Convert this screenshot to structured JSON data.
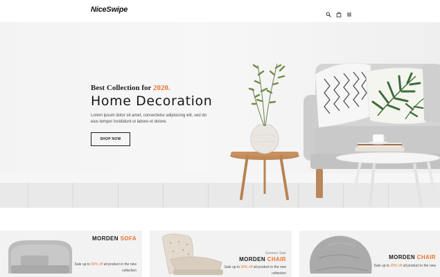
{
  "header": {
    "logo": "NiceSwipe",
    "icons": [
      "search-icon",
      "bag-icon",
      "menu-icon"
    ]
  },
  "hero": {
    "eyebrow_prefix": "Best Collection for",
    "eyebrow_year": "2020.",
    "title": "Home Decoration",
    "text": "Lorem ipsum dolor sit amet, consectetur adipisicing elit, sed do eius tempor incididunt ut labore et dolore.",
    "button_label": "SHOP NOW"
  },
  "cards": [
    {
      "eyebrow": "",
      "title_main": "MORDEN",
      "title_accent": "SOFA",
      "text_before": "Sale up to",
      "text_accent": "30% off",
      "text_after": "all product in the new collection"
    },
    {
      "eyebrow": "Summer Sale",
      "title_main": "MORDEN",
      "title_accent": "CHAIR",
      "text_before": "Sale up to",
      "text_accent": "30% off",
      "text_after": "all product in the new collection"
    },
    {
      "eyebrow": "",
      "title_main": "MORDEN",
      "title_accent": "CHAIR",
      "text_before": "Sale up to",
      "text_accent": "20% off",
      "text_after": "all product in the new"
    }
  ],
  "colors": {
    "accent": "#e8732c",
    "text_dark": "#161616",
    "card_bg": "#f2f2f2"
  }
}
